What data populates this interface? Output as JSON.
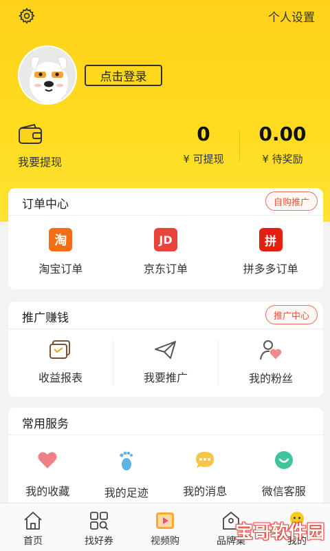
{
  "header": {
    "settings_label": "个人设置",
    "login_label": "点击登录",
    "withdraw_label": "我要提现",
    "available": {
      "value": "0",
      "label": "¥ 可提现"
    },
    "pending": {
      "value": "0.00",
      "label": "¥ 待奖励"
    }
  },
  "orders": {
    "title": "订单中心",
    "pill": "自购推广",
    "items": [
      {
        "label": "淘宝订单",
        "icon": "taobao-icon",
        "glyph": "淘"
      },
      {
        "label": "京东订单",
        "icon": "jd-icon",
        "glyph": "JD"
      },
      {
        "label": "拼多多订单",
        "icon": "pinduoduo-icon",
        "glyph": "拼"
      }
    ]
  },
  "promote": {
    "title": "推广赚钱",
    "pill": "推广中心",
    "items": [
      {
        "label": "收益报表",
        "icon": "report-icon"
      },
      {
        "label": "我要推广",
        "icon": "paper-plane-icon"
      },
      {
        "label": "我的粉丝",
        "icon": "fans-icon"
      }
    ]
  },
  "services": {
    "title": "常用服务",
    "items": [
      {
        "label": "我的收藏",
        "icon": "heart-icon"
      },
      {
        "label": "我的足迹",
        "icon": "footprint-icon"
      },
      {
        "label": "我的消息",
        "icon": "message-icon"
      },
      {
        "label": "微信客服",
        "icon": "wechat-service-icon"
      }
    ]
  },
  "tabbar": {
    "items": [
      {
        "label": "首页",
        "icon": "home-icon"
      },
      {
        "label": "找好券",
        "icon": "coupon-grid-icon"
      },
      {
        "label": "视频购",
        "icon": "video-icon"
      },
      {
        "label": "品牌集",
        "icon": "brand-icon"
      },
      {
        "label": "我的",
        "icon": "profile-icon"
      }
    ]
  },
  "watermark": "宝哥软件园",
  "colors": {
    "header_yellow": "#ffd21a",
    "pill_red": "#e2573f",
    "taobao_orange": "#f36e13",
    "jd_red": "#e8443a",
    "pdd_red": "#e52012"
  }
}
